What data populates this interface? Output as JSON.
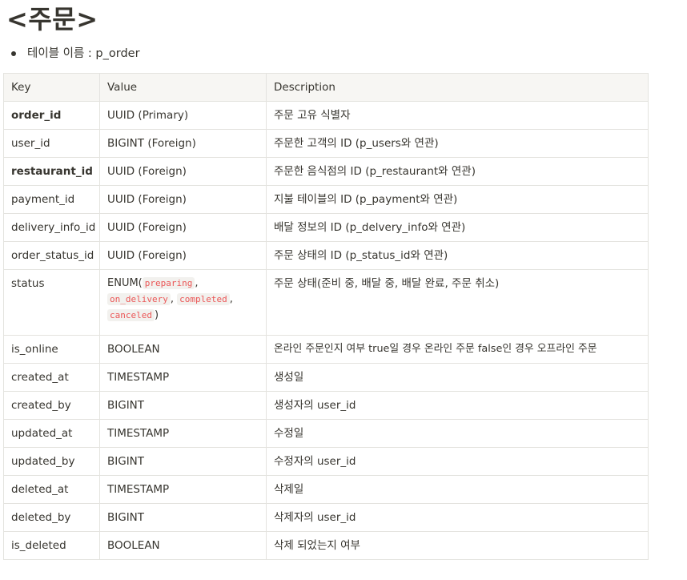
{
  "heading": "<주문>",
  "table_name_line": "테이블 이름 : p_order",
  "columns": [
    "Key",
    "Value",
    "Description"
  ],
  "rows": [
    {
      "key": "order_id",
      "value": "UUID (Primary)",
      "desc": "주문 고유 식별자",
      "bold": true
    },
    {
      "key": "user_id",
      "value": "BIGINT (Foreign)",
      "desc": "주문한 고객의 ID (p_users와 연관)",
      "bold": false
    },
    {
      "key": "restaurant_id",
      "value": "UUID (Foreign)",
      "desc": "주문한 음식점의 ID (p_restaurant와 연관)",
      "bold": true
    },
    {
      "key": "payment_id",
      "value": "UUID (Foreign)",
      "desc": "지불 테이블의 ID (p_payment와 연관)",
      "bold": false
    },
    {
      "key": "delivery_info_id",
      "value": "UUID (Foreign)",
      "desc": "배달 정보의 ID (p_delvery_info와 연관)",
      "bold": false
    },
    {
      "key": "order_status_id",
      "value": "UUID (Foreign)",
      "desc": "주문 상태의 ID (p_status_id와 연관)",
      "bold": false
    },
    {
      "key": "status",
      "value": "ENUM",
      "desc": "주문 상태(준비 중, 배달 중, 배달 완료, 주문 취소)",
      "bold": false
    },
    {
      "key": "is_online",
      "value": "BOOLEAN",
      "desc": "온라인 주문인지 여부 true일 경우 온라인 주문 false인 경우 오프라인 주문",
      "bold": false
    },
    {
      "key": "created_at",
      "value": "TIMESTAMP",
      "desc": "생성일",
      "bold": false
    },
    {
      "key": "created_by",
      "value": "BIGINT",
      "desc": "생성자의 user_id",
      "bold": false
    },
    {
      "key": "updated_at",
      "value": "TIMESTAMP",
      "desc": "수정일",
      "bold": false
    },
    {
      "key": "updated_by",
      "value": "BIGINT",
      "desc": "수정자의 user_id",
      "bold": false
    },
    {
      "key": "deleted_at",
      "value": "TIMESTAMP",
      "desc": "삭제일",
      "bold": false
    },
    {
      "key": "deleted_by",
      "value": "BIGINT",
      "desc": "삭제자의 user_id",
      "bold": false
    },
    {
      "key": "is_deleted",
      "value": "BOOLEAN",
      "desc": "삭제 되었는지 여부",
      "bold": false
    }
  ],
  "enum_values": [
    "preparing",
    "on_delivery",
    "completed",
    "canceled"
  ]
}
